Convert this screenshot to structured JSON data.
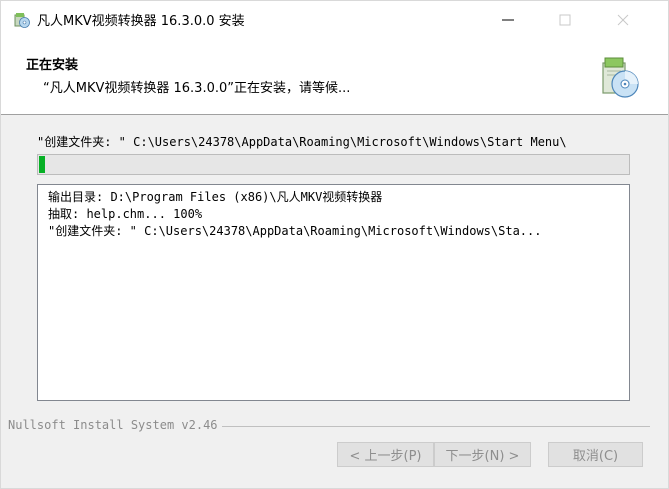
{
  "window": {
    "title": "凡人MKV视频转换器 16.3.0.0 安装",
    "controls": {
      "minimize": "—",
      "maximize": "□",
      "close": "✕"
    }
  },
  "header": {
    "title": "正在安装",
    "subtitle": "“凡人MKV视频转换器 16.3.0.0”正在安装，请等候..."
  },
  "status": {
    "text": "\"创建文件夹: \" C:\\Users\\24378\\AppData\\Roaming\\Microsoft\\Windows\\Start Menu\\",
    "progress_fraction": 0.01
  },
  "log": {
    "lines": [
      "输出目录: D:\\Program Files (x86)\\凡人MKV视频转换器",
      "抽取: help.chm... 100%",
      "\"创建文件夹: \" C:\\Users\\24378\\AppData\\Roaming\\Microsoft\\Windows\\Sta..."
    ]
  },
  "footer": {
    "branding": "Nullsoft Install System v2.46",
    "buttons": {
      "back": "< 上一步(P)",
      "next": "下一步(N) >",
      "cancel": "取消(C)"
    }
  },
  "colors": {
    "progress_fill": "#06b025",
    "disabled_text": "#8e8e8e"
  },
  "icons": {
    "app": "installer-cd-icon",
    "header_logo": "installer-cd-icon"
  }
}
